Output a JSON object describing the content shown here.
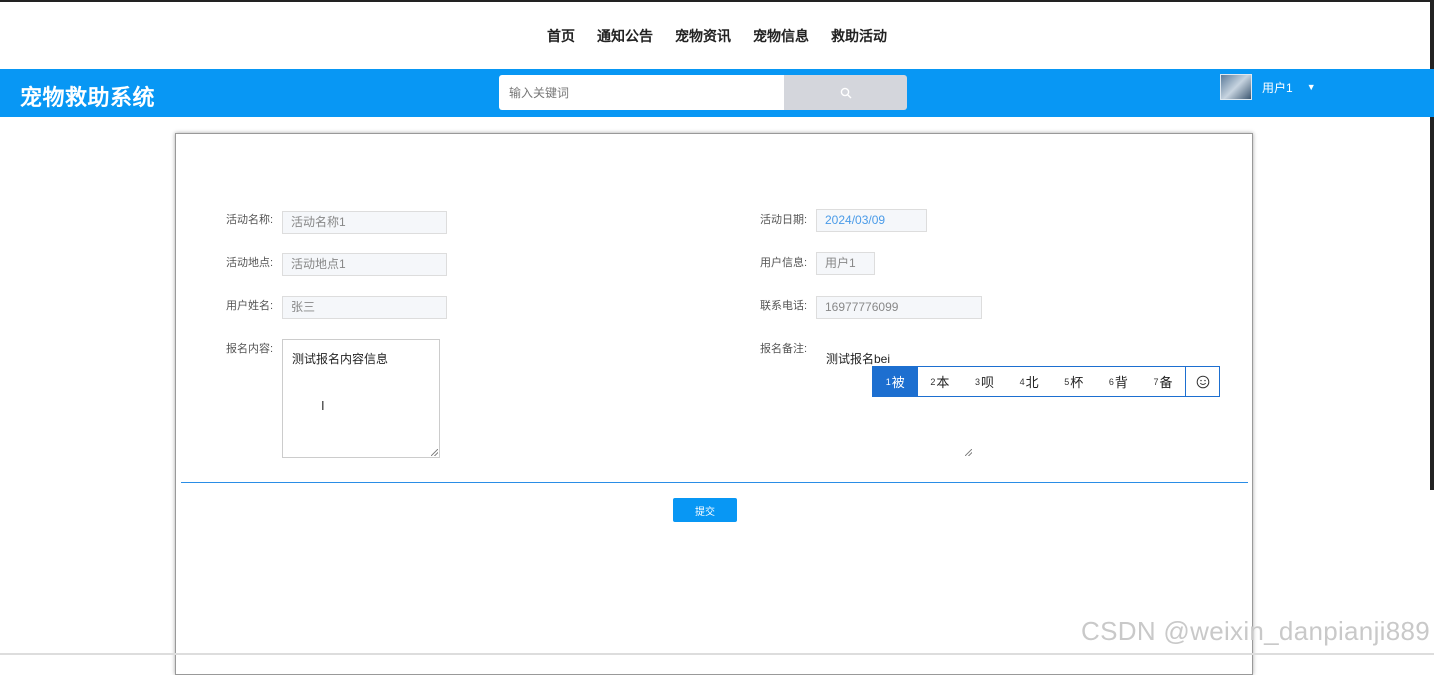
{
  "nav": {
    "items": [
      "首页",
      "通知公告",
      "宠物资讯",
      "宠物信息",
      "救助活动"
    ]
  },
  "header": {
    "brand": "宠物救助系统",
    "search_placeholder": "输入关键词",
    "user_name": "用户1"
  },
  "form": {
    "activity_name": {
      "label": "活动名称:",
      "value": "活动名称1"
    },
    "activity_date": {
      "label": "活动日期:",
      "value": "2024/03/09"
    },
    "activity_place": {
      "label": "活动地点:",
      "value": "活动地点1"
    },
    "user_info": {
      "label": "用户信息:",
      "value": "用户1"
    },
    "user_name": {
      "label": "用户姓名:",
      "value": "张三"
    },
    "phone": {
      "label": "联系电话:",
      "value": "16977776099"
    },
    "content": {
      "label": "报名内容:",
      "value": "测试报名内容信息"
    },
    "remark": {
      "label": "报名备注:",
      "value": "测试报名bei"
    },
    "submit_label": "提交"
  },
  "ime": {
    "candidates": [
      {
        "n": "1",
        "t": "被"
      },
      {
        "n": "2",
        "t": "本"
      },
      {
        "n": "3",
        "t": "呗"
      },
      {
        "n": "4",
        "t": "北"
      },
      {
        "n": "5",
        "t": "杯"
      },
      {
        "n": "6",
        "t": "背"
      },
      {
        "n": "7",
        "t": "备"
      }
    ]
  },
  "watermark": "CSDN @weixin_danpianji889",
  "colors": {
    "primary": "#0897f4",
    "ime_accent": "#1d6fd0"
  }
}
